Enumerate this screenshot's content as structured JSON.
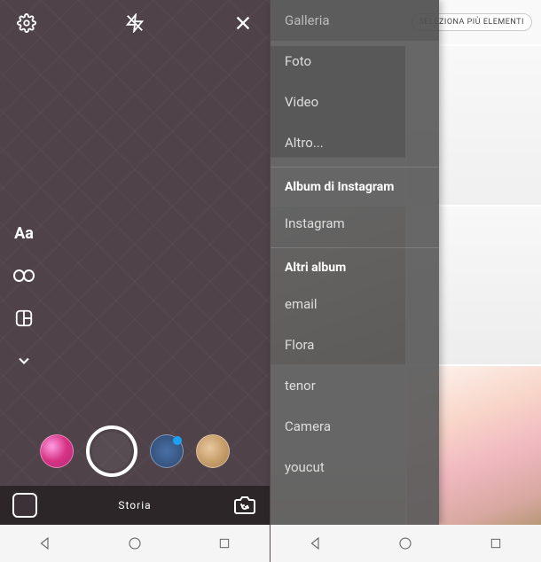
{
  "left": {
    "side_tools": {
      "text_tool": "Aa"
    },
    "mode_label": "Storia"
  },
  "right": {
    "select_multi_label": "SELEZIONA PIÙ ELEMENTI",
    "dropdown": {
      "current": "Galleria",
      "items_main": [
        "Foto",
        "Video",
        "Altro..."
      ],
      "header_ig": "Album di Instagram",
      "items_ig": [
        "Instagram"
      ],
      "header_other": "Altri album",
      "items_other": [
        "email",
        "Flora",
        "tenor",
        "Camera",
        "youcut"
      ]
    }
  }
}
